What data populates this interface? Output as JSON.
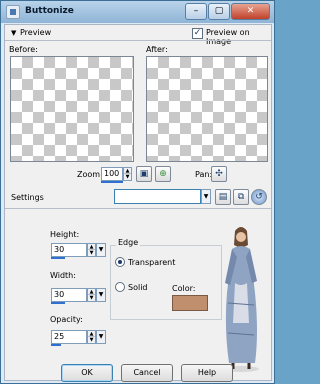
{
  "window": {
    "title": "Buttonize",
    "minimize_glyph": "–",
    "maximize_glyph": "▢",
    "close_glyph": "✕"
  },
  "preview": {
    "section_label": "Preview",
    "preview_on_image_label": "Preview on Image",
    "before_label": "Before:",
    "after_label": "After:",
    "zoom_label": "Zoom:",
    "zoom_value": "100",
    "pan_label": "Pan:"
  },
  "settings": {
    "label": "Settings",
    "preset_value": ""
  },
  "controls": {
    "height_label": "Height:",
    "height_value": "30",
    "width_label": "Width:",
    "width_value": "30",
    "opacity_label": "Opacity:",
    "opacity_value": "25"
  },
  "edge": {
    "group_label": "Edge",
    "options": [
      "Transparent",
      "Solid"
    ],
    "selected": "Transparent",
    "color_label": "Color:",
    "color_value": "#c0906e"
  },
  "buttons": {
    "ok": "OK",
    "cancel": "Cancel",
    "help": "Help"
  },
  "icons": {
    "collapse": "triangle-down-icon",
    "fit": "fit-window-icon",
    "zoom": "zoom-icon",
    "pan": "pan-icon",
    "save": "save-icon",
    "manage": "manage-presets-icon",
    "reset": "reset-icon"
  }
}
